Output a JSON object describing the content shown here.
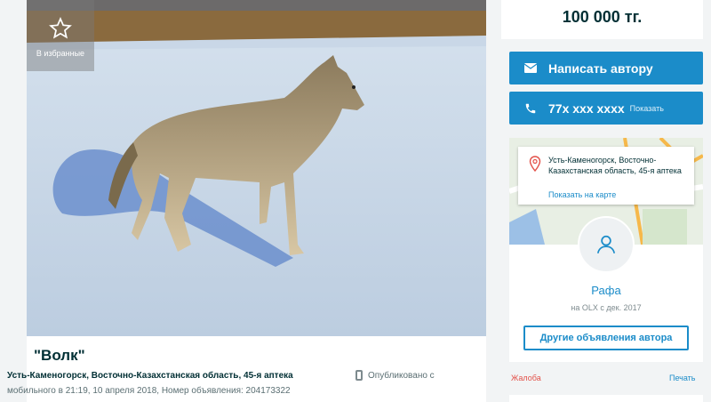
{
  "photo": {
    "favorite_label": "В избранные"
  },
  "ad": {
    "title": "\"Волк\"",
    "location": "Усть-Каменогорск, Восточно-Казахстанская область, 45-я аптека",
    "published_label": "Опубликовано с",
    "meta": "мобильного  в 21:19, 10 апреля 2018, Номер объявления: 204173322"
  },
  "price": "100 000 тг.",
  "actions": {
    "write_label": "Написать автору",
    "phone_masked": "77x xxx xxxx",
    "phone_show": "Показать"
  },
  "seller": {
    "address": "Усть-Каменогорск, Восточно-Казахстанская область, 45-я аптека",
    "map_link": "Показать на карте",
    "name": "Рафа",
    "since": "на OLX с дек. 2017",
    "other_ads": "Другие объявления автора"
  },
  "footer": {
    "complaint": "Жалоба",
    "print": "Печать"
  },
  "colors": {
    "accent": "#1b8cc9",
    "danger": "#e3524a",
    "text": "#002f34"
  },
  "icons": [
    "star-icon",
    "envelope-icon",
    "phone-icon",
    "map-pin-icon",
    "user-icon",
    "mobile-icon"
  ]
}
